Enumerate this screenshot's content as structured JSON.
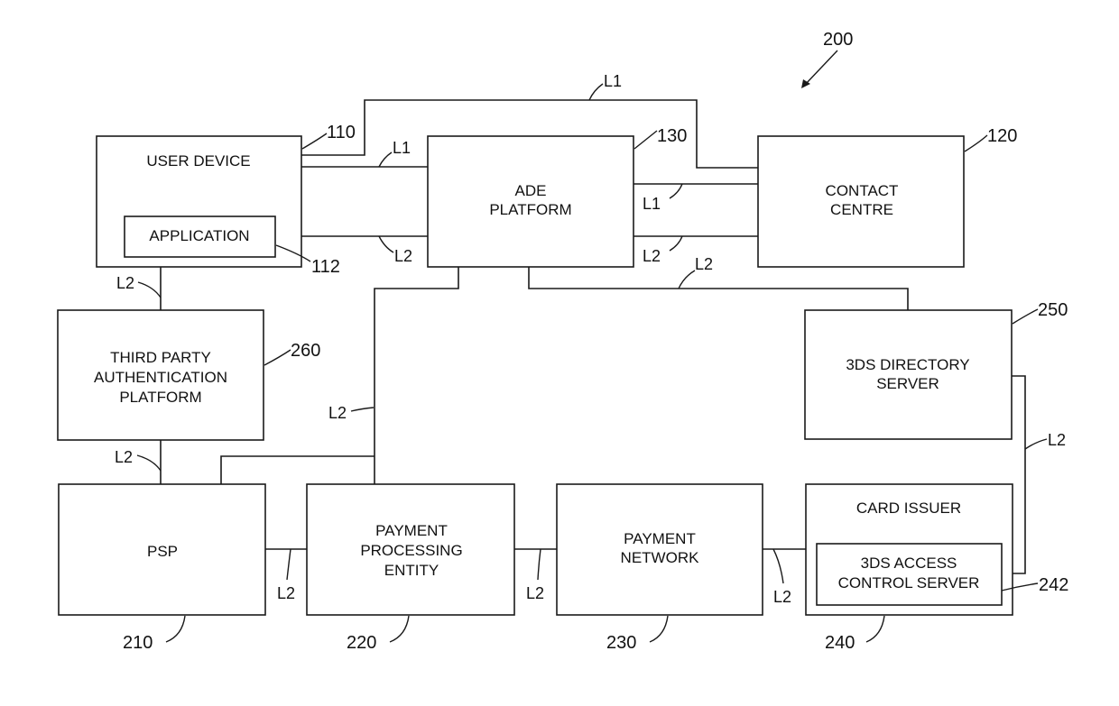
{
  "figure": {
    "ref": "200"
  },
  "blocks": {
    "user_device": {
      "label": "USER DEVICE",
      "ref": "110"
    },
    "application": {
      "label": "APPLICATION",
      "ref": "112"
    },
    "ade_platform": {
      "lines": [
        "ADE",
        "PLATFORM"
      ],
      "ref": "130"
    },
    "contact_centre": {
      "lines": [
        "CONTACT",
        "CENTRE"
      ],
      "ref": "120"
    },
    "third_party_auth": {
      "lines": [
        "THIRD PARTY",
        "AUTHENTICATION",
        "PLATFORM"
      ],
      "ref": "260"
    },
    "directory_server": {
      "lines": [
        "3DS DIRECTORY",
        "SERVER"
      ],
      "ref": "250"
    },
    "psp": {
      "label": "PSP",
      "ref": "210"
    },
    "payment_processing": {
      "lines": [
        "PAYMENT",
        "PROCESSING",
        "ENTITY"
      ],
      "ref": "220"
    },
    "payment_network": {
      "lines": [
        "PAYMENT",
        "NETWORK"
      ],
      "ref": "230"
    },
    "card_issuer": {
      "label": "CARD ISSUER",
      "ref": "240"
    },
    "access_control_server": {
      "lines": [
        "3DS ACCESS",
        "CONTROL SERVER"
      ],
      "ref": "242"
    }
  },
  "links": {
    "l1": "L1",
    "l2": "L2"
  }
}
